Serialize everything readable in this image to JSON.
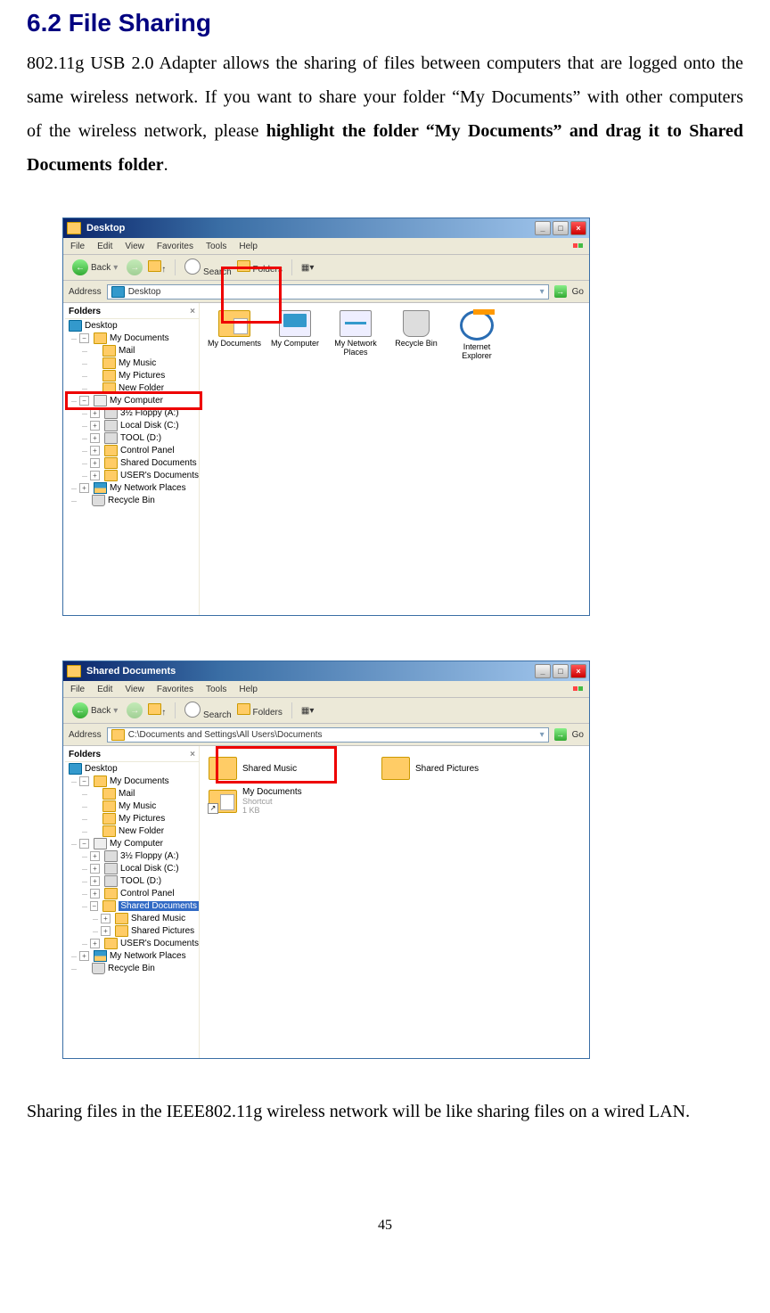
{
  "section": {
    "heading": "6.2 File Sharing",
    "para1_a": "802.11g USB 2.0 Adapter allows the sharing of files between computers that are logged onto the same wireless network. If you want to share your folder “My Documents” with other computers of the wireless network, please ",
    "para1_b": "highlight the folder “My Documents” and drag it to Shared Documents folder",
    "para1_c": ".",
    "para2": "Sharing files in the IEEE802.11g wireless network will be like sharing files on a wired LAN.",
    "pagenum": "45"
  },
  "win1": {
    "title": "Desktop",
    "menu": {
      "file": "File",
      "edit": "Edit",
      "view": "View",
      "fav": "Favorites",
      "tools": "Tools",
      "help": "Help"
    },
    "tb": {
      "back": "Back",
      "search": "Search",
      "folders": "Folders"
    },
    "addr": {
      "label": "Address",
      "value": "Desktop",
      "go": "Go"
    },
    "sidebar_title": "Folders",
    "tree": {
      "desktop": "Desktop",
      "mydocs": "My Documents",
      "mail": "Mail",
      "music": "My Music",
      "pictures": "My Pictures",
      "newfolder": "New Folder",
      "mycomp": "My Computer",
      "floppy": "3½ Floppy (A:)",
      "localc": "Local Disk (C:)",
      "toold": "TOOL (D:)",
      "control": "Control Panel",
      "shared": "Shared Documents",
      "userdocs": "USER's Documents",
      "netplaces": "My Network Places",
      "recycle": "Recycle Bin"
    },
    "content": {
      "mydocs": "My Documents",
      "mycomp": "My Computer",
      "netplaces": "My Network Places",
      "recycle": "Recycle Bin",
      "ie": "Internet Explorer"
    }
  },
  "win2": {
    "title": "Shared Documents",
    "addr": {
      "label": "Address",
      "value": "C:\\Documents and Settings\\All Users\\Documents",
      "go": "Go"
    },
    "tree": {
      "shmusic": "Shared Music",
      "shpic": "Shared Pictures",
      "userdocs": "USER's Documents"
    },
    "content": {
      "smusic": "Shared Music",
      "spics": "Shared Pictures",
      "mydocs": "My Documents",
      "shortcut": "Shortcut",
      "size": "1 KB"
    }
  }
}
